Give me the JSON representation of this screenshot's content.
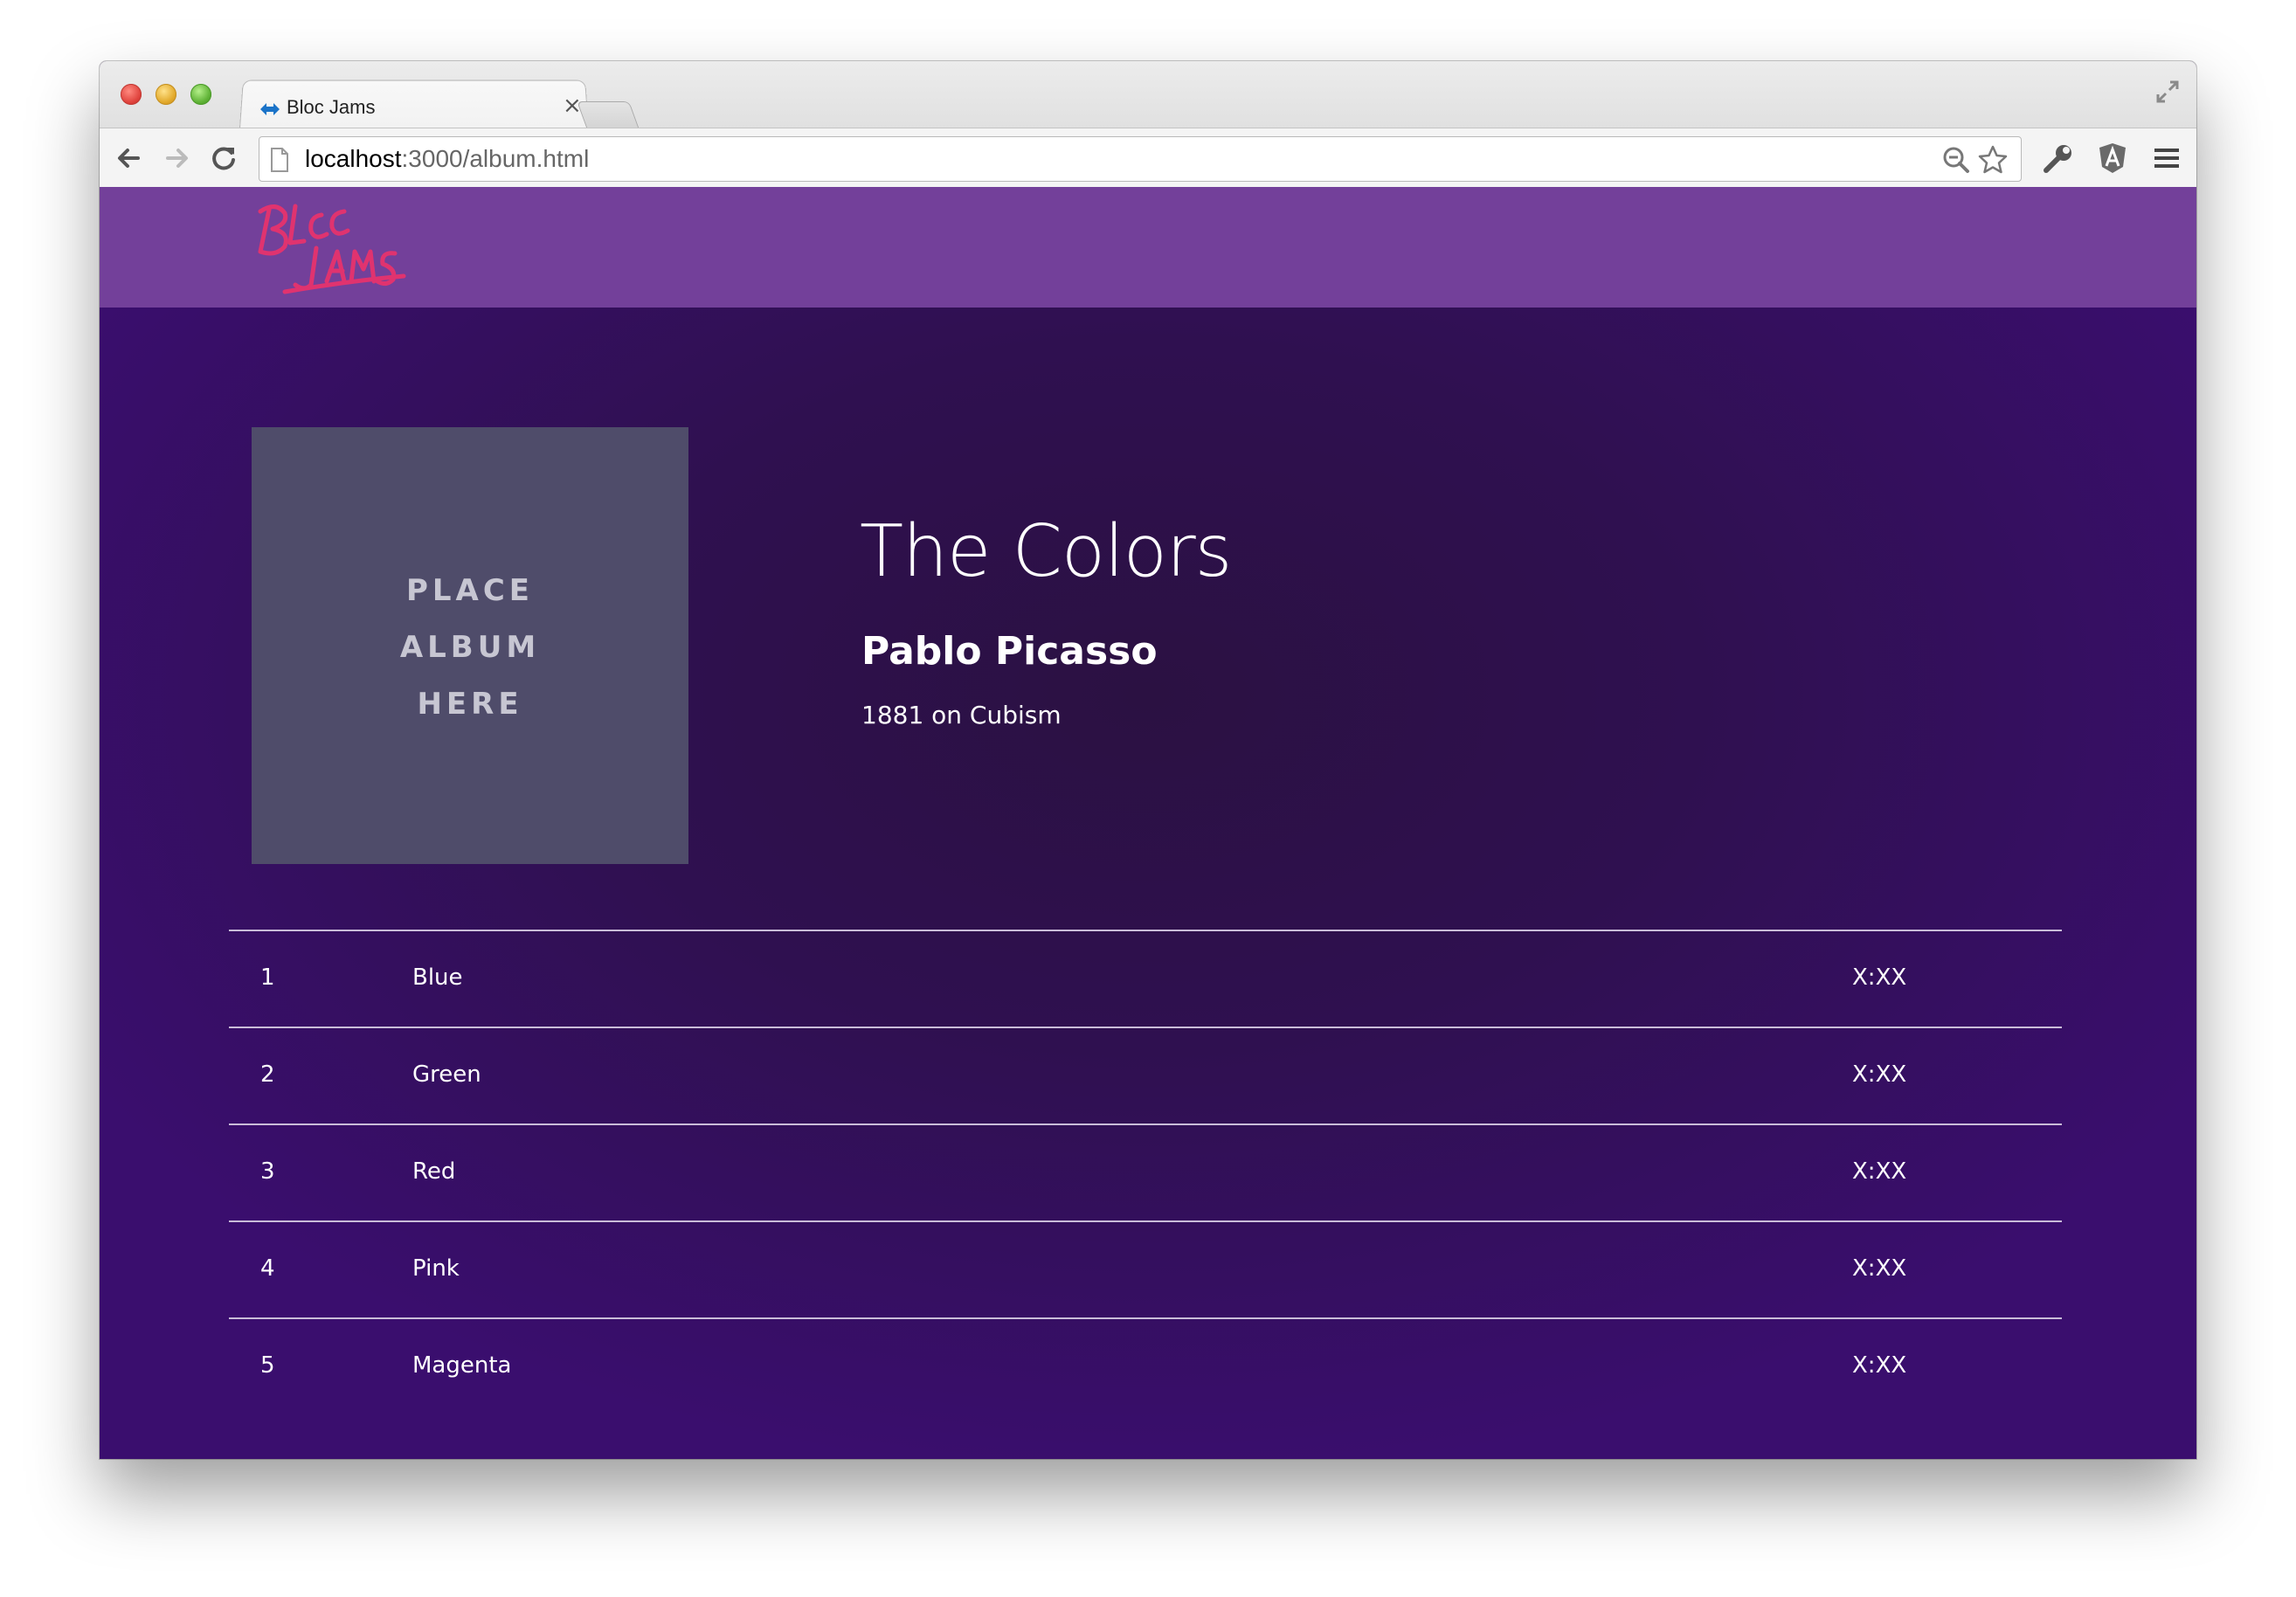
{
  "browser": {
    "tab_title": "Bloc Jams",
    "tab_close": "×",
    "url_host": "localhost",
    "url_rest": ":3000/album.html"
  },
  "site": {
    "logo_alt": "Bloc Jams",
    "nav_color": "#73409a"
  },
  "album": {
    "cover_lines": [
      "PLACE",
      "ALBUM",
      "HERE"
    ],
    "title": "The Colors",
    "artist": "Pablo Picasso",
    "release": "1881 on Cubism"
  },
  "songs": [
    {
      "number": "1",
      "name": "Blue",
      "duration": "X:XX"
    },
    {
      "number": "2",
      "name": "Green",
      "duration": "X:XX"
    },
    {
      "number": "3",
      "name": "Red",
      "duration": "X:XX"
    },
    {
      "number": "4",
      "name": "Pink",
      "duration": "X:XX"
    },
    {
      "number": "5",
      "name": "Magenta",
      "duration": "X:XX"
    }
  ]
}
